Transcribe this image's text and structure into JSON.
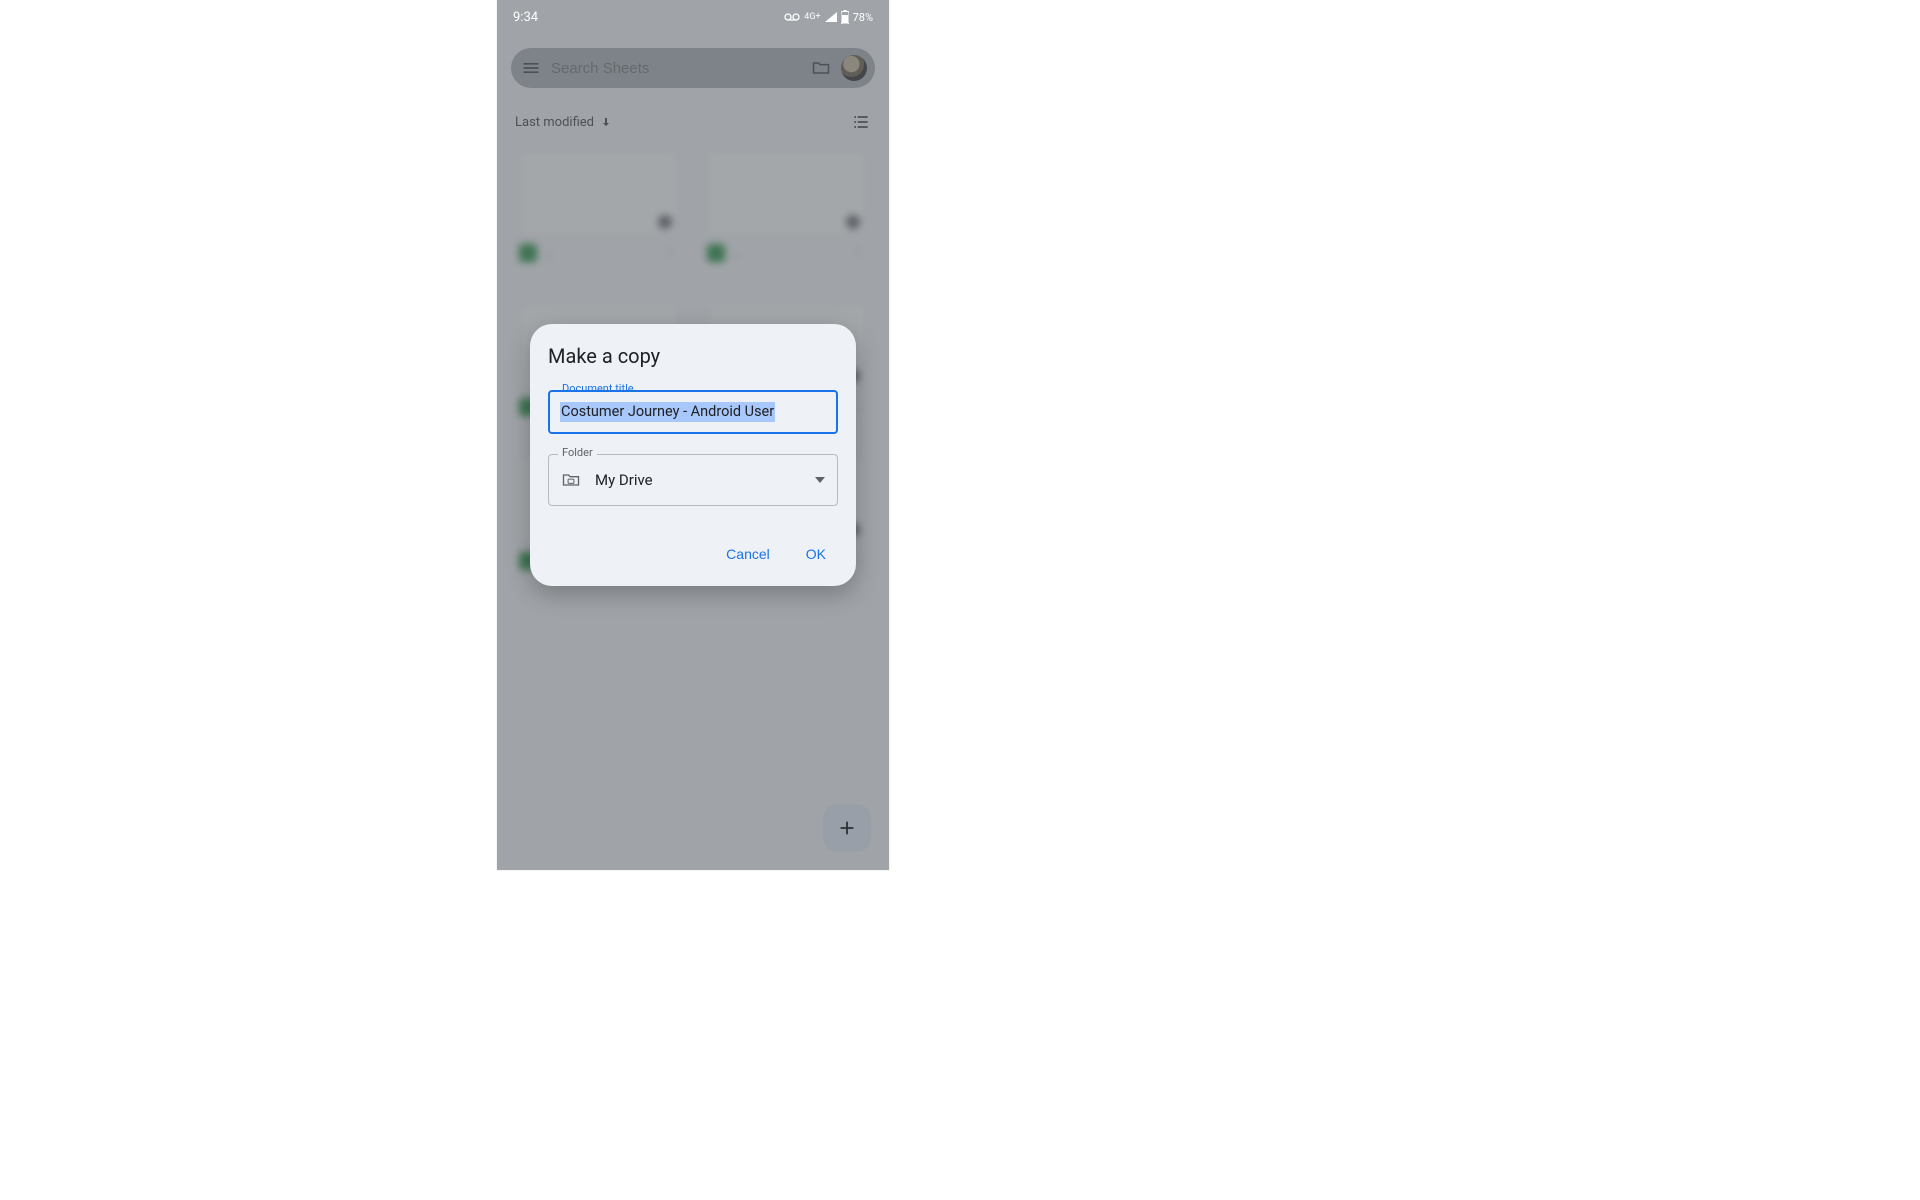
{
  "status": {
    "time": "9:34",
    "network": "4G+",
    "battery": "78%"
  },
  "search": {
    "placeholder": "Search Sheets"
  },
  "sort": {
    "label": "Last modified"
  },
  "tiles": [
    {
      "label": "…"
    },
    {
      "label": "…"
    },
    {
      "label": "…"
    },
    {
      "label": "…"
    },
    {
      "label": "…"
    },
    {
      "label": "…"
    }
  ],
  "dialog": {
    "title": "Make a copy",
    "doc_title_label": "Document title",
    "doc_title_value": "Costumer Journey - Android User",
    "folder_label": "Folder",
    "folder_value": "My Drive",
    "cancel": "Cancel",
    "ok": "OK"
  }
}
